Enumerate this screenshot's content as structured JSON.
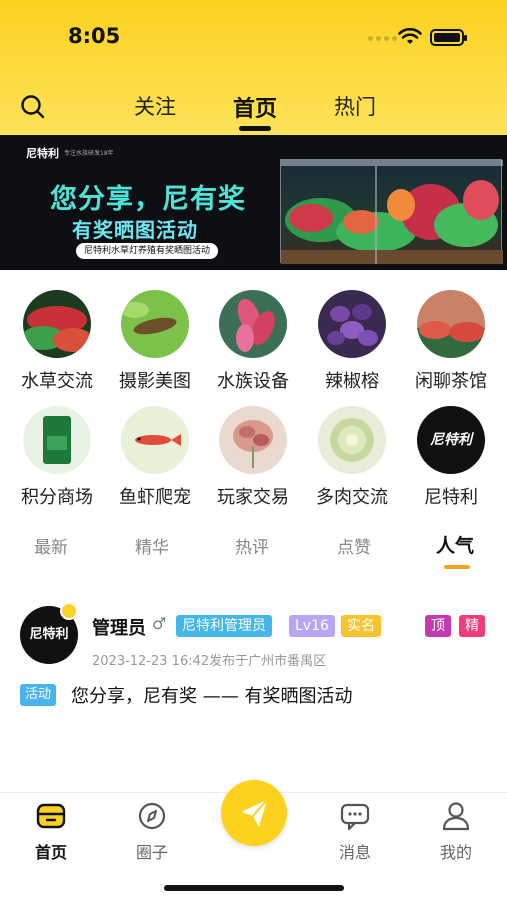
{
  "status": {
    "time": "8:05"
  },
  "top_tabs": [
    {
      "label": "关注"
    },
    {
      "label": "首页"
    },
    {
      "label": "热门"
    }
  ],
  "banner": {
    "brand": "尼特利",
    "brand_sub": "专注水族研发18年",
    "headline": "您分享，尼有奖",
    "subheadline": "有奖晒图活动",
    "caption": "尼特利水草灯养殖有奖晒图活动"
  },
  "categories": [
    {
      "label": "水草交流",
      "icon": "aquatic-plants-photo"
    },
    {
      "label": "摄影美图",
      "icon": "shrimp-photo"
    },
    {
      "label": "水族设备",
      "icon": "red-plant-photo"
    },
    {
      "label": "辣椒榕",
      "icon": "bucephalandra-photo"
    },
    {
      "label": "闲聊茶馆",
      "icon": "aquascape-photo"
    },
    {
      "label": "积分商场",
      "icon": "product-bag-photo"
    },
    {
      "label": "鱼虾爬宠",
      "icon": "fish-photo"
    },
    {
      "label": "玩家交易",
      "icon": "stem-plant-photo"
    },
    {
      "label": "多肉交流",
      "icon": "succulent-photo"
    },
    {
      "label": "尼特利",
      "icon": "brand-logo"
    }
  ],
  "filter_tabs": [
    {
      "label": "最新"
    },
    {
      "label": "精华"
    },
    {
      "label": "热评"
    },
    {
      "label": "点赞"
    },
    {
      "label": "人气"
    }
  ],
  "post": {
    "avatar_text": "尼特利",
    "username": "管理员",
    "gender": "♂",
    "badges": {
      "admin": "尼特利管理员",
      "level": "Lv16",
      "verified": "实名",
      "top": "顶",
      "essence": "精"
    },
    "meta": "2023-12-23 16:42发布于广州市番禺区",
    "tag": "活动",
    "title": "您分享，尼有奖 —— 有奖晒图活动"
  },
  "tabbar": [
    {
      "label": "首页"
    },
    {
      "label": "圈子"
    },
    {
      "label": "消息"
    },
    {
      "label": "我的"
    }
  ],
  "colors": {
    "brand_yellow": "#fcd21f",
    "accent_orange": "#f7a51c"
  }
}
